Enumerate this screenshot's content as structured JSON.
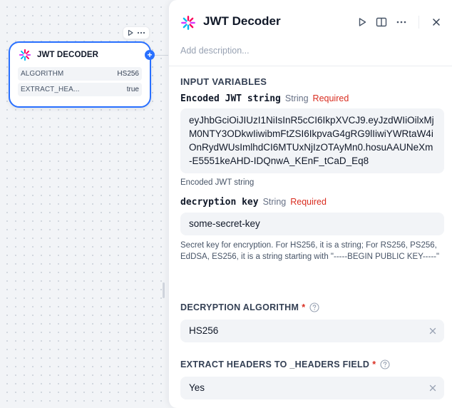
{
  "node": {
    "title": "JWT DECODER",
    "params": [
      {
        "key": "ALGORITHM",
        "value": "HS256"
      },
      {
        "key": "EXTRACT_HEA...",
        "value": "true"
      }
    ]
  },
  "panel": {
    "title": "JWT Decoder",
    "description_placeholder": "Add description...",
    "input_section_title": "INPUT VARIABLES",
    "variables": [
      {
        "name": "Encoded JWT string",
        "type": "String",
        "required_label": "Required",
        "value": "eyJhbGciOiJIUzI1NiIsInR5cCI6IkpXVCJ9.eyJzdWIiOilxMjM0NTY3ODkwIiwibmFtZSI6IkpvaG4gRG9lIiwiYWRtaW4iOnRydWUsImlhdCI6MTUxNjIzOTAyMn0.hosuAAUNeXm-E5551keAHD-IDQnwA_KEnF_tCaD_Eq8",
        "hint": "Encoded JWT string"
      },
      {
        "name": "decryption key",
        "type": "String",
        "required_label": "Required",
        "value": "some-secret-key",
        "hint": "Secret key for encryption. For HS256, it is a string; For RS256, PS256, EdDSA, ES256, it is a string starting with \"-----BEGIN PUBLIC KEY-----\""
      }
    ],
    "fields": [
      {
        "label": "DECRYPTION ALGORITHM",
        "required_mark": "*",
        "value": "HS256"
      },
      {
        "label": "EXTRACT HEADERS TO _HEADERS FIELD",
        "required_mark": "*",
        "value": "Yes"
      }
    ]
  },
  "icons": {
    "logo": "jwt-logo-icon",
    "run": "play-icon",
    "split": "book-open-icon",
    "more": "more-horizontal-icon",
    "close": "close-icon",
    "help": "help-circle-icon",
    "clear": "clear-x-icon",
    "add": "plus-icon"
  },
  "colors": {
    "accent": "#2970ff",
    "required": "#d92d20"
  }
}
